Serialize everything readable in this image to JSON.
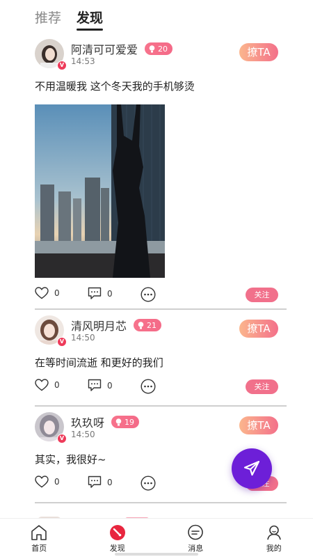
{
  "top_tabs": [
    {
      "label": "推荐",
      "active": false
    },
    {
      "label": "发现",
      "active": true
    }
  ],
  "posts": [
    {
      "name": "阿清可可爱爱",
      "level": "20",
      "time": "14:53",
      "text": "不用温暖我  这个冬天我的手机够烫",
      "has_photo": true,
      "likes": "0",
      "comments": "0",
      "flirt_label": "撩TA",
      "follow_label": "关注"
    },
    {
      "name": "清风明月芯",
      "level": "21",
      "time": "14:50",
      "text": "在等时间流逝  和更好的我们",
      "has_photo": false,
      "likes": "0",
      "comments": "0",
      "flirt_label": "撩TA",
      "follow_label": "关注"
    },
    {
      "name": "玖玖呀",
      "level": "19",
      "time": "14:50",
      "text": "其实，我很好~",
      "has_photo": false,
      "likes": "0",
      "comments": "0",
      "flirt_label": "撩TA",
      "follow_label": "关注"
    }
  ],
  "verified_mark": "V",
  "bottom_nav": [
    {
      "label": "首页",
      "icon": "home-icon",
      "active": false
    },
    {
      "label": "发现",
      "icon": "discover-compass-icon",
      "active": true
    },
    {
      "label": "消息",
      "icon": "message-icon",
      "active": false
    },
    {
      "label": "我的",
      "icon": "profile-icon",
      "active": false
    }
  ],
  "colors": {
    "accent_pink": "#f1708b",
    "flirt_gradient_start": "#fbb68d",
    "flirt_gradient_end": "#f3708a",
    "fab_purple": "#6d1fd8",
    "active_nav_red": "#e8263f"
  }
}
